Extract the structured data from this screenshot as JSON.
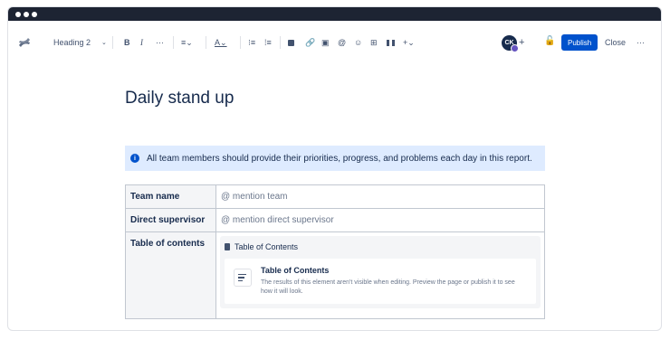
{
  "toolbar": {
    "text_style": "Heading 2",
    "avatar_initials": "CK",
    "publish": "Publish",
    "close": "Close"
  },
  "page": {
    "title": "Daily stand up",
    "info": "All team members should provide their priorities, progress, and problems each day in this report."
  },
  "table": {
    "rows": [
      {
        "header": "Team name",
        "value": "@ mention team"
      },
      {
        "header": "Direct supervisor",
        "value": "@ mention direct supervisor"
      },
      {
        "header": "Table of contents"
      }
    ],
    "toc": {
      "head": "Table of Contents",
      "card_title": "Table of Contents",
      "card_desc": "The results of this element aren't visible when editing. Preview the page or publish it to see how it will look."
    }
  },
  "colors": {
    "titlebar": "#1d2433",
    "accent": "#0052cc",
    "info_bg": "#deebff"
  }
}
